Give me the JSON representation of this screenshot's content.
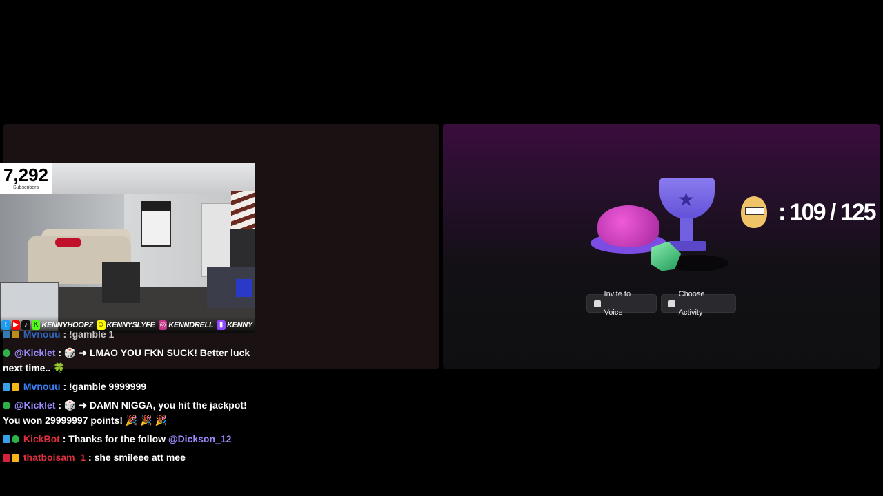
{
  "subscriber_widget": {
    "count": "7,292",
    "label": "Subscribers"
  },
  "socials": [
    {
      "icon": "twitter-icon",
      "color": "#1d9bf0"
    },
    {
      "icon": "youtube-icon",
      "color": "#ff0000"
    },
    {
      "icon": "tiktok-icon",
      "color": "#111111"
    },
    {
      "icon": "kick-icon",
      "color": "#53fc18",
      "handle": "KENNYHOOPZ"
    },
    {
      "icon": "snapchat-icon",
      "color": "#fffc00",
      "handle": "KENNYSLYFE"
    },
    {
      "icon": "instagram-icon",
      "color": "#c13584",
      "handle": "KENNDRELL"
    },
    {
      "icon": "twitch-icon",
      "color": "#9146ff",
      "handle": "KENNY"
    }
  ],
  "chat": [
    {
      "user": "Mvnouu",
      "user_color": "#3b82f6",
      "text": ": !gamble 1"
    },
    {
      "user": "@Kicklet",
      "user_color": "#9b8cff",
      "text": ": 🎲 ➜ LMAO YOU FKN SUCK! Better luck next time.. 🍀"
    },
    {
      "user": "Mvnouu",
      "user_color": "#3b82f6",
      "text": ": !gamble 9999999"
    },
    {
      "user": "@Kicklet",
      "user_color": "#9b8cff",
      "text": ": 🎲 ➜ DAMN NIGGA, you hit the jackpot! You won 29999997 points! 🎉 🎉 🎉"
    },
    {
      "user": "KickBot",
      "user_color": "#e0303f",
      "text": ": Thanks for the follow",
      "mention": "@Dickson_12"
    },
    {
      "user": "thatboisam_1",
      "user_color": "#e0303f",
      "text": ": she smileee att mee"
    }
  ],
  "goal": {
    "counter": ": 109 / 125"
  },
  "buttons": {
    "invite": "Invite to Voice",
    "activity": "Choose Activity"
  },
  "colors": {
    "accent_purple": "#3a0d3c",
    "panel_dark": "#1a1212"
  }
}
